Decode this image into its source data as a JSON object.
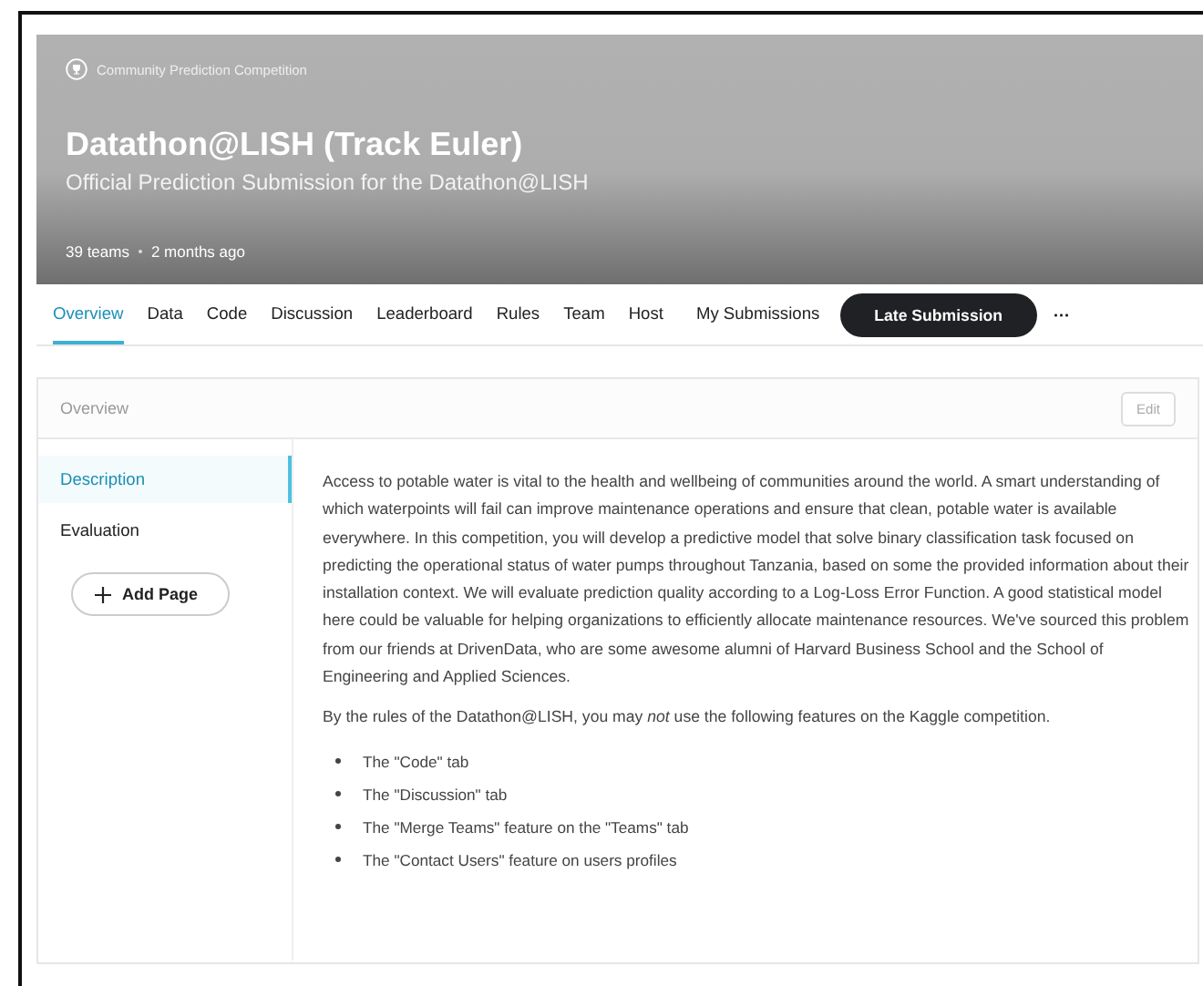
{
  "header": {
    "category": "Community Prediction Competition",
    "title": "Datathon@LISH (Track Euler)",
    "subtitle": "Official Prediction Submission for the Datathon@LISH",
    "meta": [
      "39 teams",
      "2 months ago"
    ]
  },
  "tabs": [
    {
      "label": "Overview",
      "selected": true
    },
    {
      "label": "Data",
      "selected": false
    },
    {
      "label": "Code",
      "selected": false
    },
    {
      "label": "Discussion",
      "selected": false
    },
    {
      "label": "Leaderboard",
      "selected": false
    },
    {
      "label": "Rules",
      "selected": false
    },
    {
      "label": "Team",
      "selected": false
    },
    {
      "label": "Host",
      "selected": false
    },
    {
      "label": "My Submissions",
      "selected": false
    }
  ],
  "late_submission_button": "Late Submission",
  "more_button": "···",
  "overview": {
    "heading": "Overview",
    "edit_button": "Edit",
    "sidebar": {
      "items": [
        {
          "label": "Description",
          "selected": true
        },
        {
          "label": "Evaluation",
          "selected": false
        }
      ],
      "add_button": "Add Page"
    },
    "paragraphs": [
      "Access to potable water is vital to the health and wellbeing of communities around the world. A smart understanding of which waterpoints will fail can improve maintenance operations and ensure that clean, potable water is available everywhere. In this competition, you will develop a predictive model that solve binary classification task focused on predicting the operational status of water pumps throughout Tanzania, based on some the provided information about their installation context. We will evaluate prediction quality according to a Log-Loss Error Function. A good statistical model here could be valuable for helping organizations to efficiently allocate maintenance resources. We've sourced this problem from our friends at DrivenData, who are some awesome alumni of Harvard Business School and the School of Engineering and Applied Sciences.",
      "By the rules of the Datathon@LISH, you may *not* use the following features on the Kaggle competition."
    ],
    "bullets": [
      "The \"Code\" tab",
      "The \"Discussion\" tab",
      "The \"Merge Teams\" feature on the \"Teams\" tab",
      "The \"Contact Users\" feature on users profiles"
    ]
  }
}
